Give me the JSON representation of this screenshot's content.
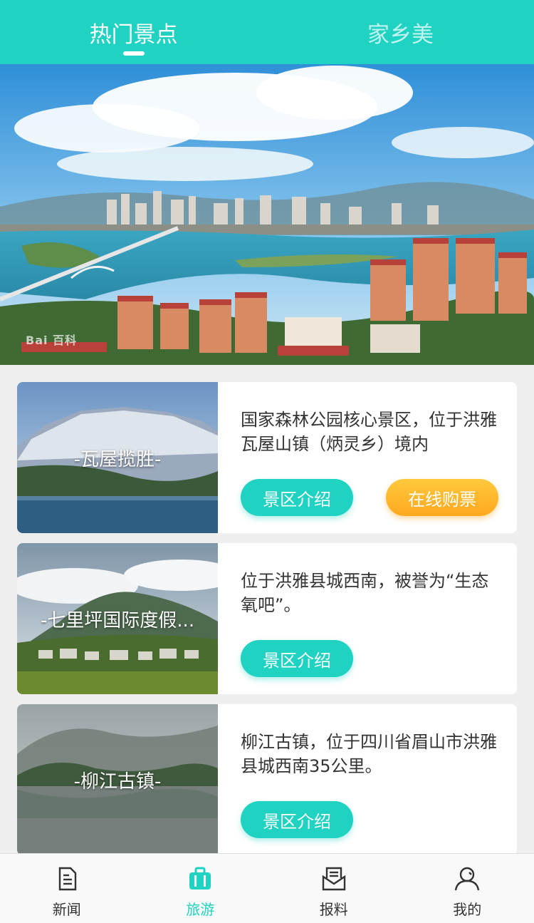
{
  "tabs": [
    {
      "label": "热门景点",
      "active": true
    },
    {
      "label": "家乡美",
      "active": false
    }
  ],
  "banner": {
    "watermark": "Bai 百科"
  },
  "spots": [
    {
      "caption": "-瓦屋揽胜-",
      "description": "国家森林公园核心景区，位于洪雅瓦屋山镇（炳灵乡）境内",
      "intro_button": "景区介绍",
      "buy_button": "在线购票"
    },
    {
      "caption": "-七里坪国际度假...",
      "description": "位于洪雅县城西南，被誉为“生态氧吧”。",
      "intro_button": "景区介绍"
    },
    {
      "caption": "-柳江古镇-",
      "description": "柳江古镇，位于四川省眉山市洪雅县城西南35公里。",
      "intro_button": "景区介绍"
    }
  ],
  "bottom_nav": [
    {
      "label": "新闻",
      "icon": "news-icon",
      "active": false
    },
    {
      "label": "旅游",
      "icon": "suitcase-icon",
      "active": true
    },
    {
      "label": "报料",
      "icon": "envelope-icon",
      "active": false
    },
    {
      "label": "我的",
      "icon": "user-icon",
      "active": false
    }
  ],
  "colors": {
    "accent": "#1fd2c2",
    "buy": "#ffb02a"
  }
}
